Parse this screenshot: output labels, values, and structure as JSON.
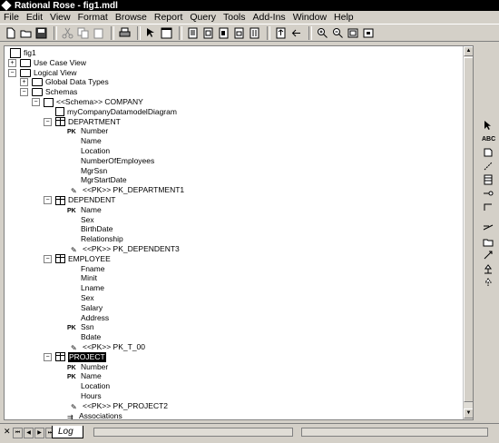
{
  "window": {
    "title": "Rational Rose - fig1.mdl"
  },
  "menu": [
    "File",
    "Edit",
    "View",
    "Format",
    "Browse",
    "Report",
    "Query",
    "Tools",
    "Add-Ins",
    "Window",
    "Help"
  ],
  "toolbar_icons": [
    "new-icon",
    "open-icon",
    "save-icon",
    "cut-icon",
    "copy-icon",
    "paste-icon",
    "print-icon",
    "context-help-icon",
    "browser-toggle-icon",
    "doc-window-icon",
    "class-diagram-icon",
    "component-diagram-icon",
    "deployment-diagram-icon",
    "sequence-diagram-icon",
    "browse-parent-icon",
    "browse-previous-icon",
    "zoom-in-icon",
    "zoom-out-icon",
    "fit-window-icon",
    "undo-fit-icon"
  ],
  "tree": {
    "root": "fig1",
    "use_case_view": "Use Case View",
    "logical_view": "Logical View",
    "global_data_types": "Global Data Types",
    "schemas": "Schemas",
    "schema": "<<Schema>> COMPANY",
    "diagram": "myCompanyDatamodelDiagram",
    "pk_tag": "PK",
    "tables": [
      {
        "name": "DEPARTMENT",
        "columns": [
          {
            "name": "Number",
            "pk": true
          },
          {
            "name": "Name",
            "pk": false
          },
          {
            "name": "Location",
            "pk": false
          },
          {
            "name": "NumberOfEmployees",
            "pk": false
          },
          {
            "name": "MgrSsn",
            "pk": false
          },
          {
            "name": "MgrStartDate",
            "pk": false
          }
        ],
        "key": "<<PK>> PK_DEPARTMENT1"
      },
      {
        "name": "DEPENDENT",
        "columns": [
          {
            "name": "Name",
            "pk": true
          },
          {
            "name": "Sex",
            "pk": false
          },
          {
            "name": "BirthDate",
            "pk": false
          },
          {
            "name": "Relationship",
            "pk": false
          }
        ],
        "key": "<<PK>> PK_DEPENDENT3"
      },
      {
        "name": "EMPLOYEE",
        "columns": [
          {
            "name": "Fname",
            "pk": false
          },
          {
            "name": "Minit",
            "pk": false
          },
          {
            "name": "Lname",
            "pk": false
          },
          {
            "name": "Sex",
            "pk": false
          },
          {
            "name": "Salary",
            "pk": false
          },
          {
            "name": "Address",
            "pk": false
          },
          {
            "name": "Ssn",
            "pk": true
          },
          {
            "name": "Bdate",
            "pk": false
          }
        ],
        "key": "<<PK>> PK_T_00"
      },
      {
        "name": "PROJECT",
        "selected": true,
        "columns": [
          {
            "name": "Number",
            "pk": true
          },
          {
            "name": "Name",
            "pk": true
          },
          {
            "name": "Location",
            "pk": false
          },
          {
            "name": "Hours",
            "pk": false
          }
        ],
        "key": "<<PK>> PK_PROJECT2"
      }
    ],
    "associations": "Associations"
  },
  "palette_icons": [
    "selection-arrow-icon",
    "text-box-icon",
    "note-icon",
    "anchor-note-icon",
    "class-icon",
    "interface-icon",
    "association-icon",
    "package-icon",
    "dependency-icon",
    "generalization-icon",
    "realization-icon"
  ],
  "palette_text": "ABC",
  "bottom": {
    "log_tab": "Log"
  }
}
